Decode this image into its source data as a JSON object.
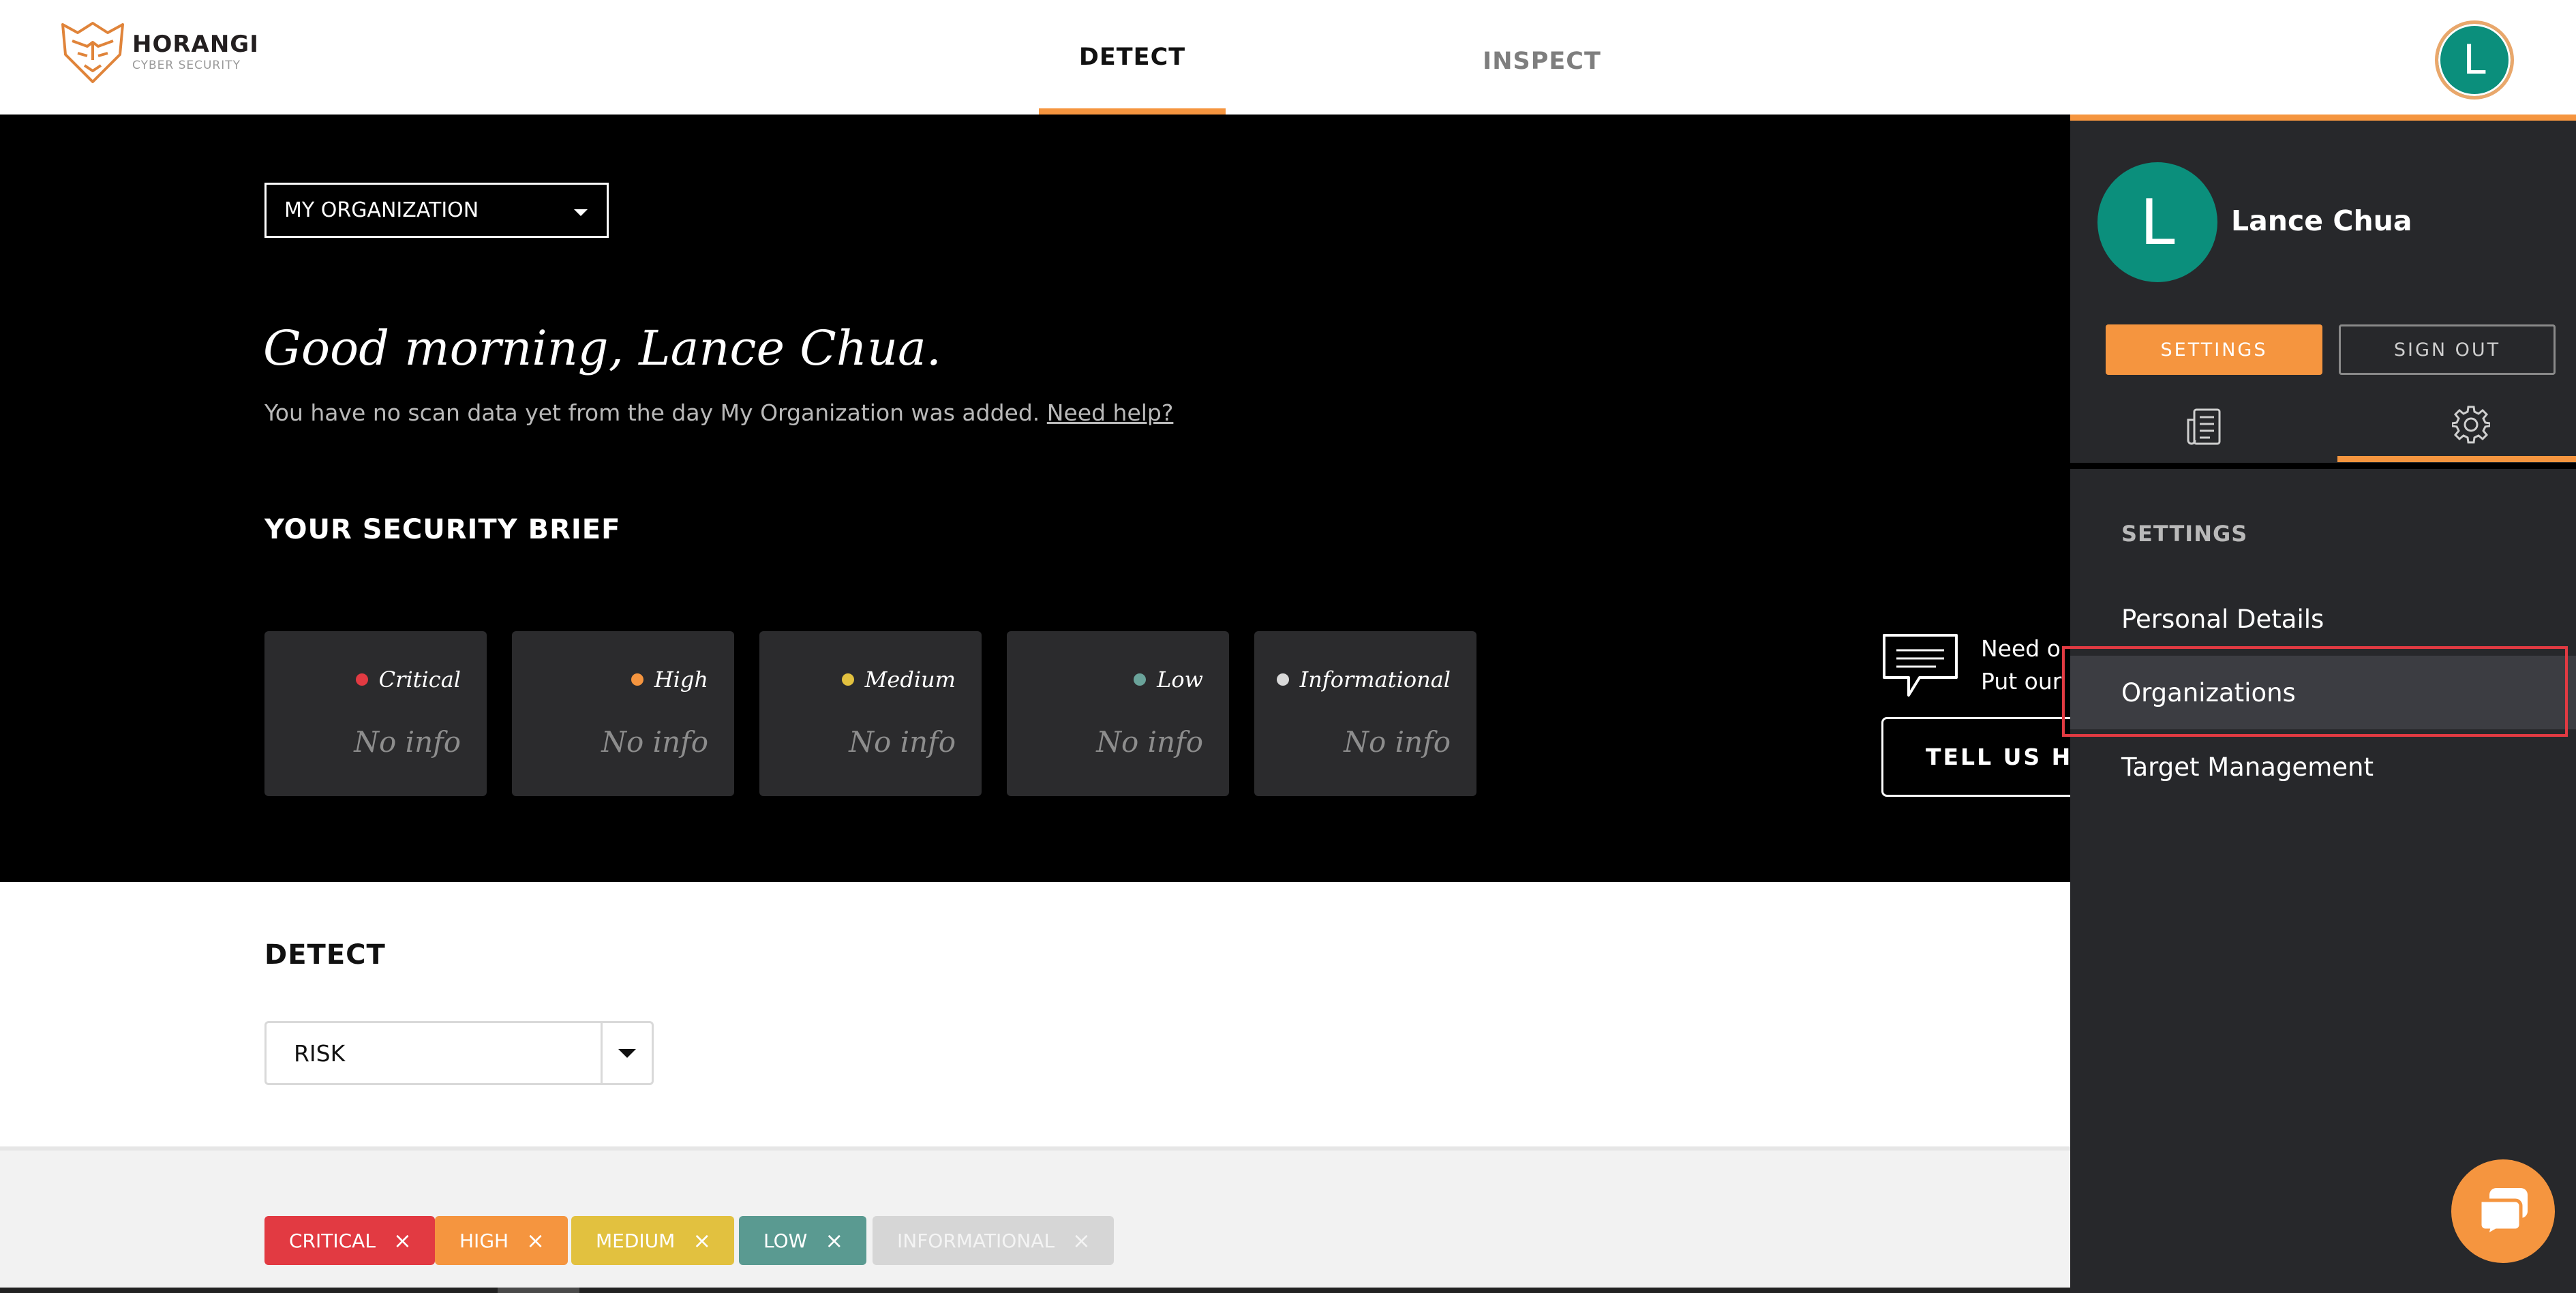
{
  "header": {
    "logo": {
      "name": "HORANGI",
      "sub": "CYBER SECURITY"
    },
    "nav": [
      {
        "label": "DETECT",
        "active": true
      },
      {
        "label": "INSPECT",
        "active": false
      }
    ],
    "avatar_initial": "L"
  },
  "hero": {
    "org_select": {
      "value": "MY ORGANIZATION"
    },
    "greeting": "Good morning, Lance Chua.",
    "subtitle": "You have no scan data yet from the day My Organization was added.",
    "help_link": "Need help?",
    "brief_title": "YOUR SECURITY BRIEF",
    "cards": [
      {
        "label": "Critical",
        "value": "No info",
        "color": "#e23a42"
      },
      {
        "label": "High",
        "value": "No info",
        "color": "#f5953f"
      },
      {
        "label": "Medium",
        "value": "No info",
        "color": "#e2c13f"
      },
      {
        "label": "Low",
        "value": "No info",
        "color": "#6aa39a"
      },
      {
        "label": "Informational",
        "value": "No info",
        "color": "#d9d9d9"
      }
    ],
    "feedback": {
      "line1": "Need o",
      "line2": "Put our",
      "button": "TELL US HOW"
    }
  },
  "detect": {
    "title": "DETECT",
    "select_value": "RISK",
    "chips": [
      {
        "label": "CRITICAL",
        "color": "#e23a42"
      },
      {
        "label": "HIGH",
        "color": "#f5953f"
      },
      {
        "label": "MEDIUM",
        "color": "#e2c13f"
      },
      {
        "label": "LOW",
        "color": "#5a9a91"
      },
      {
        "label": "INFORMATIONAL",
        "color": "#d6d6d6"
      }
    ]
  },
  "panel": {
    "avatar_initial": "L",
    "user_name": "Lance Chua",
    "settings_button": "SETTINGS",
    "signout_button": "SIGN OUT",
    "tabs": [
      {
        "icon": "news-icon",
        "active": false
      },
      {
        "icon": "gear-icon",
        "active": true
      }
    ],
    "section_title": "SETTINGS",
    "items": [
      {
        "label": "Personal Details",
        "selected": false
      },
      {
        "label": "Organizations",
        "selected": true
      },
      {
        "label": "Target Management",
        "selected": false
      }
    ]
  },
  "colors": {
    "accent": "#f5953f",
    "avatar": "#0b8f7c",
    "panel_bg": "#27282b",
    "highlight": "#e23a42"
  },
  "icons": {
    "logo": "tiger-logo-icon",
    "feedback": "speech-bubble-icon",
    "chat": "chat-icon",
    "caret": "chevron-down-icon",
    "chip_remove": "close-icon"
  }
}
